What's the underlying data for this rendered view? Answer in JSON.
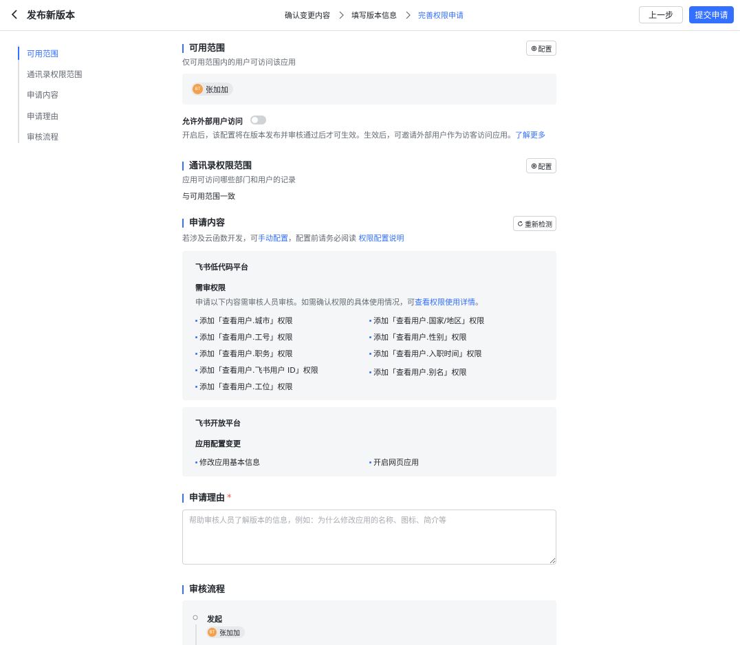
{
  "header": {
    "title": "发布新版本",
    "steps": [
      "确认变更内容",
      "填写版本信息",
      "完善权限申请"
    ],
    "prev_label": "上一步",
    "submit_label": "提交申请"
  },
  "nav": {
    "items": [
      "可用范围",
      "通讯录权限范围",
      "申请内容",
      "申请理由",
      "审核流程"
    ]
  },
  "availability": {
    "title": "可用范围",
    "desc": "仅可用范围内的用户可访问该应用",
    "config_label": "配置",
    "user": "张加加",
    "external_label": "允许外部用户访问",
    "external_desc": "开启后，该配置将在版本发布并审核通过后才可生效。生效后，可邀请外部用户作为访客访问应用。",
    "learn_more": "了解更多"
  },
  "contacts": {
    "title": "通讯录权限范围",
    "desc": "应用可访问哪些部门和用户的记录",
    "config_label": "配置",
    "value": "与可用范围一致"
  },
  "content": {
    "title": "申请内容",
    "recheck_label": "重新检测",
    "desc_prefix": "若涉及云函数开发，可",
    "desc_link1": "手动配置",
    "desc_mid": "，配置前请务必阅读",
    "desc_link2": "权限配置说明",
    "platform1": {
      "name": "飞书低代码平台",
      "sub": "需审权限",
      "desc_prefix": "申请以下内容需审核人员审核。如需确认权限的具体使用情况，可",
      "desc_link": "查看权限使用详情",
      "desc_suffix": "。",
      "left": [
        "添加「查看用户.城市」权限",
        "添加「查看用户.工号」权限",
        "添加「查看用户.职务」权限",
        "添加「查看用户.飞书用户 ID」权限",
        "添加「查看用户.工位」权限"
      ],
      "right": [
        "添加「查看用户.国家/地区」权限",
        "添加「查看用户.性别」权限",
        "添加「查看用户.入职时间」权限",
        "添加「查看用户.别名」权限"
      ]
    },
    "platform2": {
      "name": "飞书开放平台",
      "sub": "应用配置变更",
      "left": [
        "修改应用基本信息"
      ],
      "right": [
        "开启网页应用"
      ]
    }
  },
  "reason": {
    "title": "申请理由",
    "required_mark": "*",
    "placeholder": "帮助审核人员了解版本的信息，例如：为什么修改应用的名称、图标、简介等"
  },
  "review": {
    "title": "审核流程",
    "step_label": "发起",
    "user": "张加加"
  }
}
